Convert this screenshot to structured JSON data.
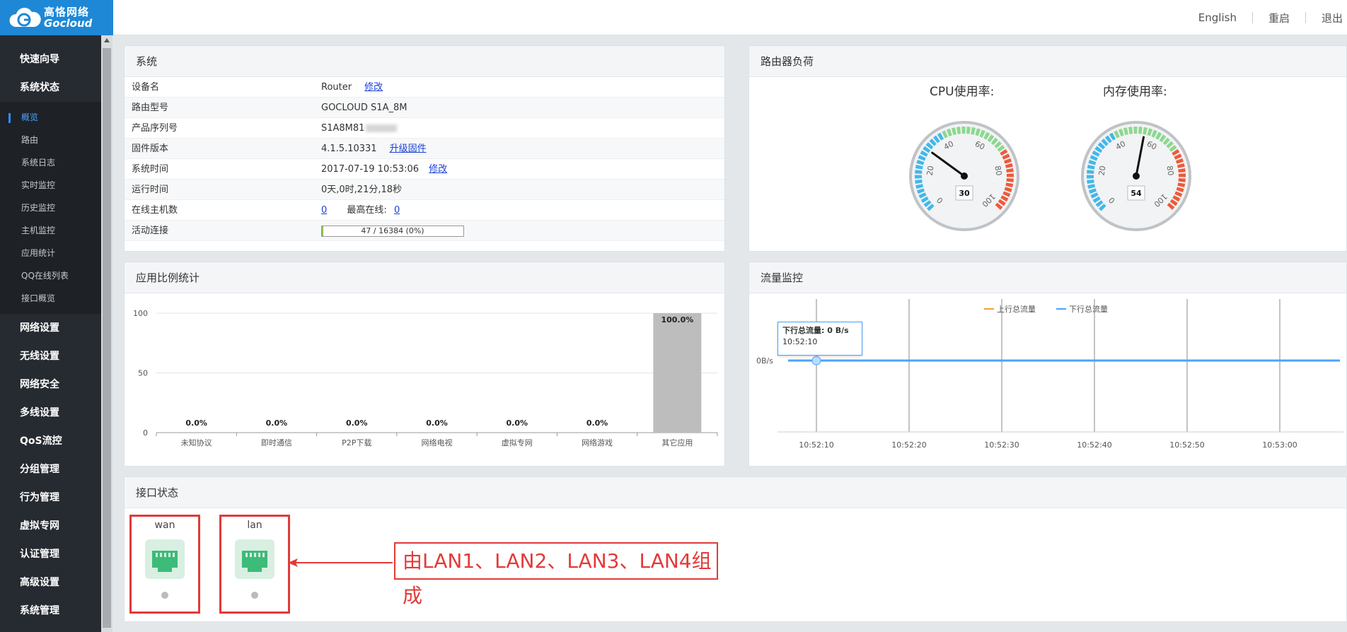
{
  "app": {
    "logo_cn": "高恪网络",
    "logo_en": "Gocloud"
  },
  "toplinks": {
    "english": "English",
    "reboot": "重启",
    "logout": "退出"
  },
  "sidebar": {
    "items_top": [
      "快速向导",
      "系统状态"
    ],
    "sub_items": [
      "概览",
      "路由",
      "系统日志",
      "实时监控",
      "历史监控",
      "主机监控",
      "应用统计",
      "QQ在线列表",
      "接口概览"
    ],
    "active_sub": "概览",
    "items_bottom": [
      "网络设置",
      "无线设置",
      "网络安全",
      "多线设置",
      "QoS流控",
      "分组管理",
      "行为管理",
      "虚拟专网",
      "认证管理",
      "高级设置",
      "系统管理"
    ]
  },
  "system": {
    "title": "系统",
    "device_name_label": "设备名",
    "device_name": "Router",
    "device_name_action": "修改",
    "model_label": "路由型号",
    "model": "GOCLOUD S1A_8M",
    "serial_label": "产品序列号",
    "serial": "S1A8M81",
    "firmware_label": "固件版本",
    "firmware": "4.1.5.10331",
    "firmware_action": "升级固件",
    "time_label": "系统时间",
    "time": "2017-07-19 10:53:06",
    "time_action": "修改",
    "uptime_label": "运行时间",
    "uptime": "0天,0时,21分,18秒",
    "hosts_label": "在线主机数",
    "hosts": "0",
    "max_online_label": "最高在线:",
    "max_online": "0",
    "conn_label": "活动连接",
    "conn": "47 / 16384 (0%)",
    "conn_fraction": 0.003
  },
  "load": {
    "title": "路由器负荷",
    "cpu_label": "CPU使用率:",
    "cpu_value": 30,
    "mem_label": "内存使用率:",
    "mem_value": 54,
    "ticks": [
      "0",
      "20",
      "40",
      "60",
      "80",
      "100"
    ]
  },
  "app_stats": {
    "title": "应用比例统计"
  },
  "traffic": {
    "title": "流量监控",
    "legend_up": "上行总流量",
    "legend_down": "下行总流量",
    "tooltip_title": "下行总流量: 0 B/s",
    "tooltip_time": "10:52:10",
    "y_label": "0B/s",
    "x_ticks": [
      "10:52:10",
      "10:52:20",
      "10:52:30",
      "10:52:40",
      "10:52:50",
      "10:53:00"
    ],
    "up_color": "#f0a030",
    "down_color": "#4aa3ff"
  },
  "interfaces": {
    "title": "接口状态",
    "ports": [
      "wan",
      "lan"
    ],
    "annotation": "由LAN1、LAN2、LAN3、LAN4组成"
  },
  "chart_data": [
    {
      "type": "bar",
      "categories": [
        "未知协议",
        "即时通信",
        "P2P下载",
        "网络电视",
        "虚拟专网",
        "网络游戏",
        "其它应用"
      ],
      "values": [
        0,
        0,
        0,
        0,
        0,
        0,
        100
      ],
      "data_labels": [
        "0.0%",
        "0.0%",
        "0.0%",
        "0.0%",
        "0.0%",
        "0.0%",
        "100.0%"
      ],
      "ylim": [
        0,
        100
      ],
      "y_ticks": [
        "0",
        "50",
        "100"
      ],
      "bar_color": "#bdbdbd"
    },
    {
      "type": "line",
      "x": [
        "10:52:10",
        "10:52:20",
        "10:52:30",
        "10:52:40",
        "10:52:50",
        "10:53:00"
      ],
      "series": [
        {
          "name": "上行总流量",
          "values": [
            0,
            0,
            0,
            0,
            0,
            0
          ]
        },
        {
          "name": "下行总流量",
          "values": [
            0,
            0,
            0,
            0,
            0,
            0
          ]
        }
      ]
    }
  ]
}
